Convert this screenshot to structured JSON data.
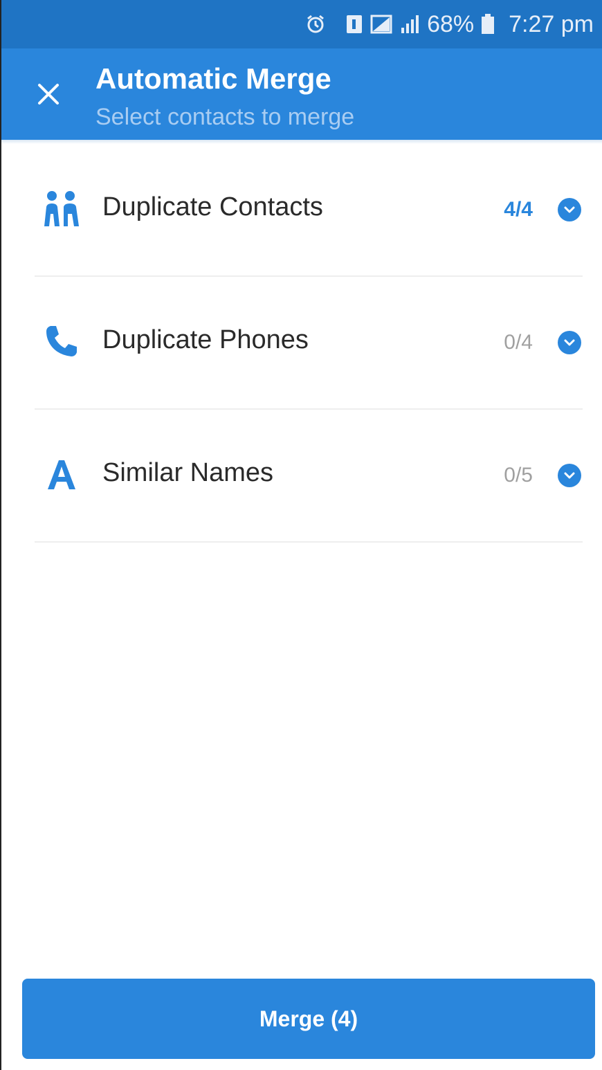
{
  "status_bar": {
    "icons": [
      "alarm-icon",
      "sim-icon",
      "no-signal-icon",
      "signal-icon",
      "battery-icon"
    ],
    "battery": "68%",
    "time": "7:27 pm"
  },
  "app_bar": {
    "close_icon": "close-icon",
    "title": "Automatic Merge",
    "subtitle": "Select contacts to merge"
  },
  "list": {
    "items": [
      {
        "icon": "people-icon",
        "label": "Duplicate Contacts",
        "count": "4/4",
        "active": true,
        "expand_icon": "chevron-down-icon"
      },
      {
        "icon": "phone-icon",
        "label": "Duplicate Phones",
        "count": "0/4",
        "active": false,
        "expand_icon": "chevron-down-icon"
      },
      {
        "icon": "letter-a-icon",
        "label": "Similar Names",
        "count": "0/5",
        "active": false,
        "expand_icon": "chevron-down-icon"
      }
    ]
  },
  "merge_button": {
    "label": "Merge (4)"
  },
  "colors": {
    "primary": "#2a86dc",
    "status_bar": "#1f74c4",
    "subtitle": "#a9cdf2",
    "inactive_count": "#a0a0a0"
  }
}
